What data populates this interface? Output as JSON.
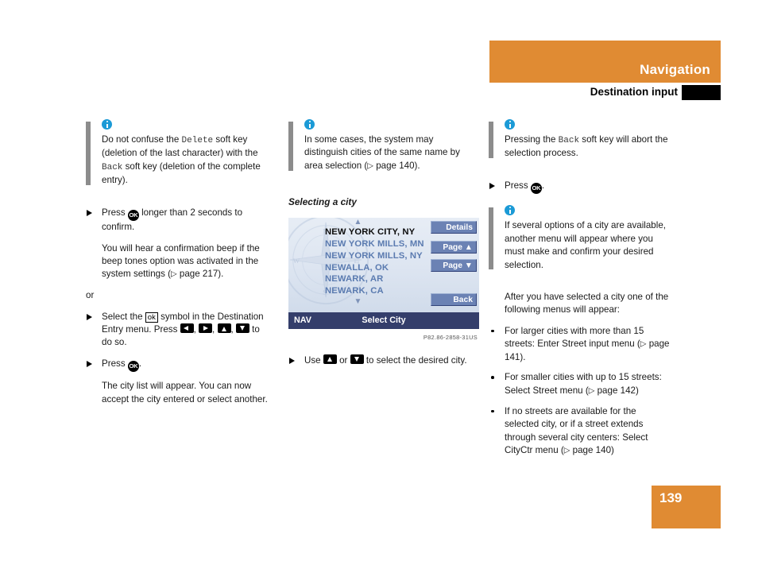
{
  "header": {
    "title": "Navigation",
    "subtitle": "Destination input",
    "accent_color": "#e08b33"
  },
  "page_number": "139",
  "columns": {
    "col1": {
      "note1": "Do not confuse the Delete soft key (deletion of the last character) with the Back soft key (deletion of the complete entry).",
      "note1_parts": {
        "a": "Do not confuse the ",
        "delete_key": "Delete",
        "b": " soft key (deletion of the last character) with the ",
        "back_key": "Back",
        "c": " soft key (deletion of the complete entry)."
      },
      "step1_a": "Press ",
      "step1_ok": "OK",
      "step1_b": " longer than 2 seconds to confirm.",
      "para1": "You will hear a confirmation beep if the beep tones option was activated in the system settings (",
      "para1_page": " page 217).",
      "or_text": "or",
      "step2_a": "Select the ",
      "step2_ok_symbol": "ok",
      "step2_b": " symbol in the Destination Entry menu. Press ",
      "step2_c": ", ",
      "step2_d": " to do so.",
      "step3_a": "Press ",
      "step3_ok": "OK",
      "step3_b": ".",
      "para2": "The city list will appear. You can now accept the city entered or select another."
    },
    "col2": {
      "note1_a": "In some cases, the system may distinguish cities of the same name by area selection (",
      "note1_page": " page 140).",
      "heading": "Selecting a city",
      "nav_screen": {
        "items": [
          {
            "label": "NEW YORK CITY, NY",
            "selected": true
          },
          {
            "label": "NEW YORK MILLS, MN",
            "selected": false
          },
          {
            "label": "NEW YORK MILLS, NY",
            "selected": false
          },
          {
            "label": "NEWALLA, OK",
            "selected": false
          },
          {
            "label": "NEWARK, AR",
            "selected": false
          },
          {
            "label": "NEWARK, CA",
            "selected": false
          }
        ],
        "scroll_up": "▲",
        "scroll_down": "▼",
        "softkeys": {
          "details": "Details",
          "page_up": "Page ▲",
          "page_down": "Page ▼",
          "back": "Back"
        },
        "status_left": "NAV",
        "status_center": "Select City"
      },
      "figure_caption": "P82.86-2858-31US",
      "step1_a": "Use ",
      "step1_b": " or ",
      "step1_c": " to select the desired city."
    },
    "col3": {
      "note1_a": "Pressing the ",
      "note1_back": "Back",
      "note1_b": " soft key will abort the selection process.",
      "step1_a": "Press ",
      "step1_ok": "OK",
      "step1_b": ".",
      "note2": "If several options of a city are available, another menu will appear where you must make and confirm your desired selection.",
      "para1": "After you have selected a city one of the following menus will appear:",
      "bullets": [
        {
          "text": "For larger cities with more than 15 streets: Enter Street input menu (",
          "page": " page 141)."
        },
        {
          "text": "For smaller cities with up to 15 streets: Select Street menu (",
          "page": " page 142)"
        },
        {
          "text": "If no streets are available for the selected city, or if a street extends through several city centers: Select CityCtr menu (",
          "page": " page 140)"
        }
      ]
    }
  }
}
